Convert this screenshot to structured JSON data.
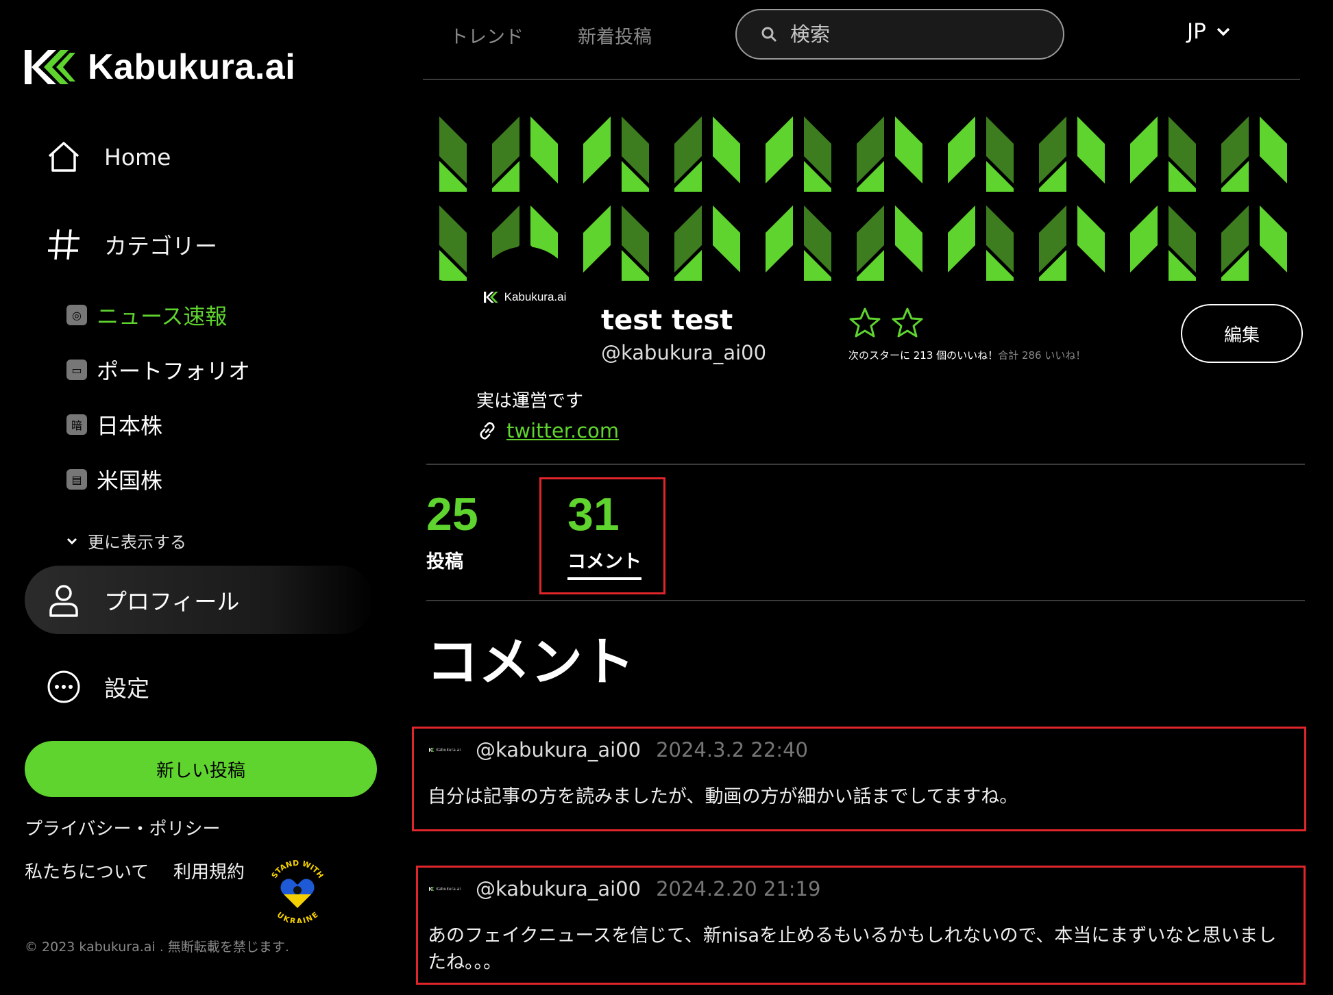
{
  "brand": {
    "name": "Kabukura.ai"
  },
  "sidebar": {
    "nav": [
      {
        "label": "Home"
      },
      {
        "label": "カテゴリー"
      }
    ],
    "categories": [
      {
        "label": "ニュース速報",
        "active": true
      },
      {
        "label": "ポートフォリオ"
      },
      {
        "label": "日本株",
        "icon_text": "暗"
      },
      {
        "label": "米国株"
      }
    ],
    "more_label": "更に表示する",
    "profile_label": "プロフィール",
    "settings_label": "設定",
    "new_post_label": "新しい投稿",
    "privacy_label": "プライバシー・ポリシー",
    "about_label": "私たちについて",
    "terms_label": "利用規約",
    "badge_text_top": "STAND WITH",
    "badge_text_bottom": "UKRAINE",
    "copyright": "© 2023 kabukura.ai . 無断転載を禁じます."
  },
  "topbar": {
    "trend_label": "トレンド",
    "new_label": "新着投稿",
    "search_placeholder": "検索",
    "lang": "JP"
  },
  "profile": {
    "avatar_text": "Kabukura.ai",
    "name": "test test",
    "handle": "@kabukura_ai00",
    "star_note_main": "次のスターに 213 個のいいね！",
    "star_note_sub": "合計 286 いいね！",
    "edit_label": "編集",
    "bio": "実は運営です",
    "link": "twitter.com"
  },
  "stats": {
    "posts": {
      "value": "25",
      "label": "投稿"
    },
    "comments": {
      "value": "31",
      "label": "コメント"
    }
  },
  "section_title": "コメント",
  "comments": [
    {
      "mini": "Kabukura.ai",
      "handle": "@kabukura_ai00",
      "time": "2024.3.2 22:40",
      "text": "自分は記事の方を読みましたが、動画の方が細かい話までしてますね。"
    },
    {
      "mini": "Kabukura.ai",
      "handle": "@kabukura_ai00",
      "time": "2024.2.20 21:19",
      "text": "あのフェイクニュースを信じて、新nisaを止めるもいるかもしれないので、本当にまずいなと思いましたね。。。"
    }
  ],
  "colors": {
    "accent": "#5fd42f",
    "highlight": "#e0262b",
    "background": "#000000"
  }
}
